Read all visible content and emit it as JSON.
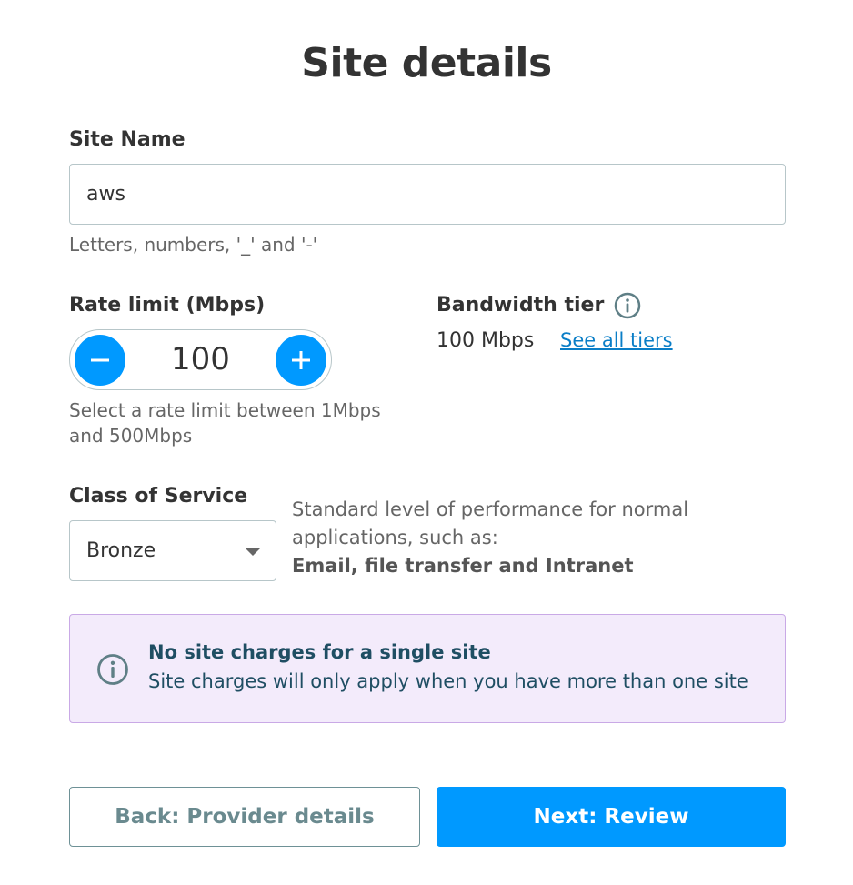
{
  "page": {
    "title": "Site details"
  },
  "site_name": {
    "label": "Site Name",
    "value": "aws",
    "hint": "Letters, numbers, '_' and '-'"
  },
  "rate_limit": {
    "label": "Rate limit (Mbps)",
    "value": "100",
    "hint_line1": "Select a rate limit between 1Mbps",
    "hint_line2": "and 500Mbps"
  },
  "bandwidth_tier": {
    "label": "Bandwidth tier",
    "value": "100 Mbps",
    "link": "See all tiers"
  },
  "class_of_service": {
    "label": "Class of Service",
    "selected": "Bronze",
    "description_line1": "Standard level of performance for normal",
    "description_line2": "applications, such as:",
    "examples": "Email, file transfer and Intranet"
  },
  "banner": {
    "title": "No site charges for a single site",
    "text": "Site charges will only apply when you have more than one site"
  },
  "actions": {
    "back_label": "Back: Provider details",
    "next_label": "Next: Review"
  },
  "colors": {
    "primary": "#0099ff",
    "banner_bg": "#f3ebfb",
    "banner_border": "#c9a9e6",
    "link": "#0a7ec7"
  },
  "icons": {
    "info": "info-circle-icon",
    "minus": "minus-icon",
    "plus": "plus-icon",
    "caret": "caret-down-icon"
  }
}
